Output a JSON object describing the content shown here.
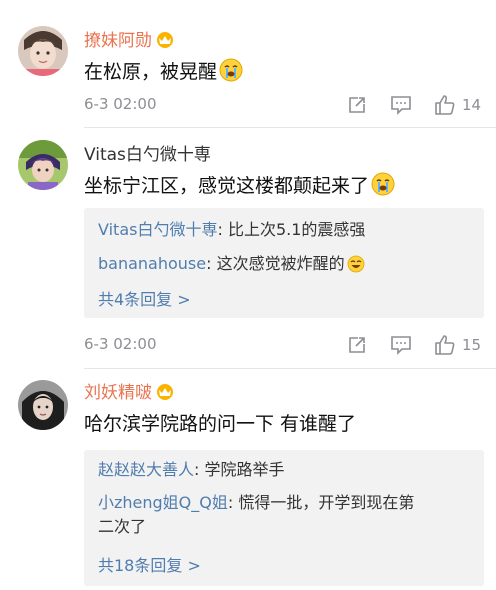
{
  "comments": [
    {
      "username": "撩妹阿勋",
      "text": "在松原，被晃醒",
      "time": "6-3 02:00",
      "likes": "14",
      "badge_icon": "vip-crown-icon",
      "emoji_icon": "crying-face-icon"
    },
    {
      "username": "Vitas白勺微十専",
      "text": "坐标宁江区，感觉这楼都颠起来了",
      "time": "6-3 02:00",
      "likes": "15",
      "emoji_icon": "crying-face-icon",
      "replies": [
        {
          "name": "Vitas白勺微十専",
          "text": ": 比上次5.1的震感强"
        },
        {
          "name": "bananahouse",
          "text": ": 这次感觉被炸醒的"
        }
      ],
      "more_replies": "共4条回复 >"
    },
    {
      "username": "刘妖精啵",
      "text": "哈尔滨学院路的问一下 有谁醒了",
      "badge_icon": "vip-crown-icon",
      "replies": [
        {
          "name": "赵赵赵大善人",
          "text": ": 学院路举手"
        },
        {
          "name": "小zheng姐Q_Q姐",
          "text": ": 慌得一批，开学到现在第",
          "text2": "二次了"
        }
      ],
      "more_replies": "共18条回复 >"
    }
  ],
  "colors": {
    "vip_name": "#eb7350",
    "reply_name": "#507daf",
    "meta_gray": "#8e8e93",
    "reply_bg": "#f2f2f2"
  }
}
